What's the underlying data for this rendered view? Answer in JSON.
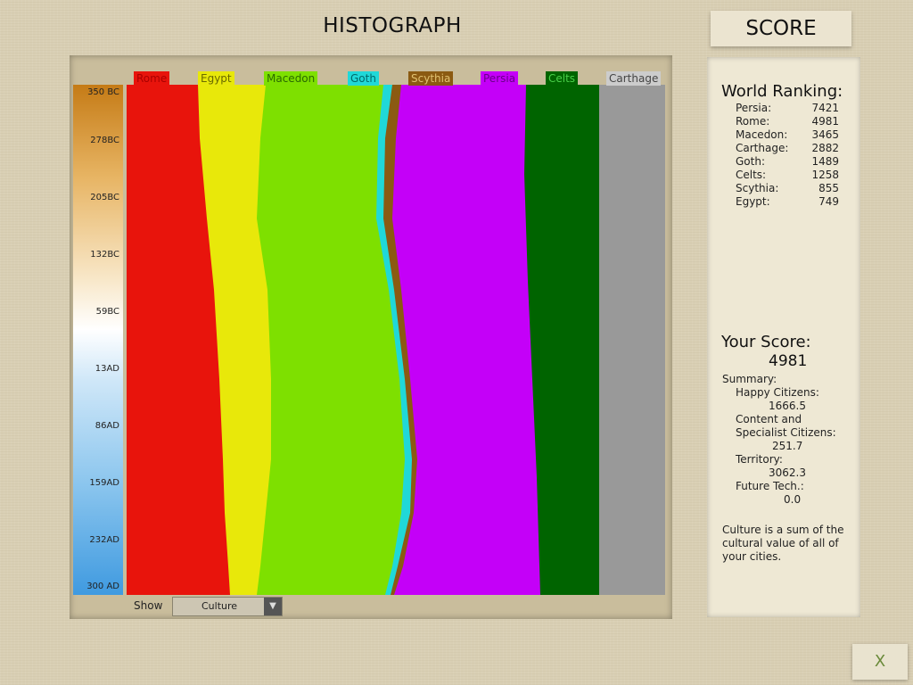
{
  "header": {
    "title": "HISTOGRAPH",
    "score_tab": "SCORE"
  },
  "timeline": {
    "ticks": [
      "350 BC",
      "278BC",
      "205BC",
      "132BC",
      "59BC",
      "13AD",
      "86AD",
      "159AD",
      "232AD",
      "300 AD"
    ]
  },
  "legend": [
    {
      "name": "Rome",
      "color": "#e8140c"
    },
    {
      "name": "Egypt",
      "color": "#e8e80a"
    },
    {
      "name": "Macedon",
      "color": "#7ee000"
    },
    {
      "name": "Goth",
      "color": "#20d8d8"
    },
    {
      "name": "Scythia",
      "color": "#8b5a12"
    },
    {
      "name": "Persia",
      "color": "#c400f8"
    },
    {
      "name": "Celts",
      "color": "#006400"
    },
    {
      "name": "Carthage",
      "color": "#999999"
    }
  ],
  "controls": {
    "show_label": "Show",
    "show_value": "Culture"
  },
  "ranking": {
    "title": "World Ranking:",
    "rows": [
      {
        "name": "Persia:",
        "score": "7421"
      },
      {
        "name": "Rome:",
        "score": "4981"
      },
      {
        "name": "Macedon:",
        "score": "3465"
      },
      {
        "name": "Carthage:",
        "score": "2882"
      },
      {
        "name": "Goth:",
        "score": "1489"
      },
      {
        "name": "Celts:",
        "score": "1258"
      },
      {
        "name": "Scythia:",
        "score": "855"
      },
      {
        "name": "Egypt:",
        "score": "749"
      }
    ]
  },
  "your_score": {
    "title": "Your Score:",
    "value": "4981",
    "summary_label": "Summary:",
    "happy_label": "Happy Citizens:",
    "happy_value": "1666.5",
    "content_label_1": "Content and",
    "content_label_2": "Specialist Citizens:",
    "content_value": "251.7",
    "territory_label": "Territory:",
    "territory_value": "3062.3",
    "future_label": "Future Tech.:",
    "future_value": "0.0",
    "note_1": "Culture is a sum of the",
    "note_2": "cultural value of all of",
    "note_3": "your cities."
  },
  "close_button": {
    "label": "X"
  }
}
